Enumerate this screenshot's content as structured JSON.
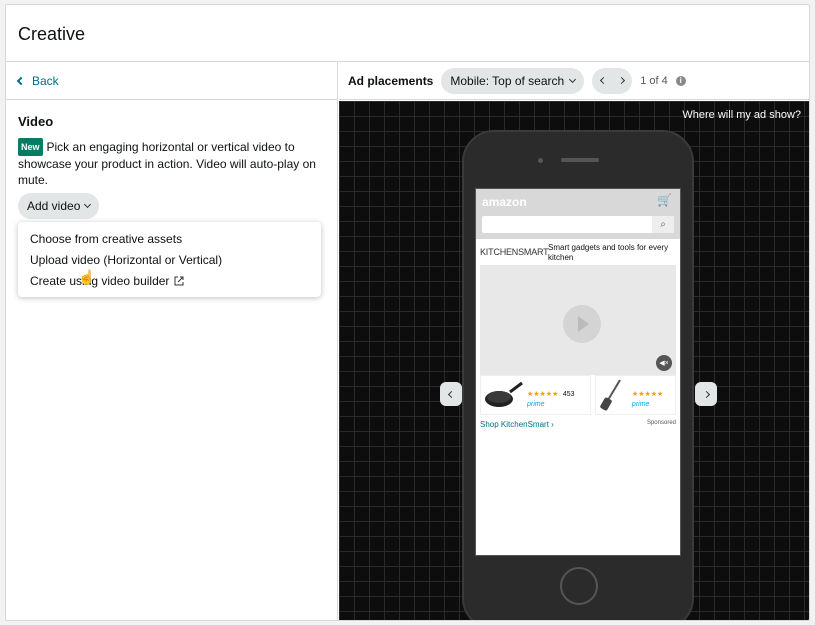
{
  "title": "Creative",
  "back": {
    "label": "Back"
  },
  "video": {
    "heading": "Video",
    "badge": "New",
    "description": "Pick an engaging horizontal or vertical video to showcase your product in action. Video will auto-play on mute.",
    "add_button": "Add video"
  },
  "dropdown": {
    "items": [
      {
        "label": "Choose from creative assets"
      },
      {
        "label": "Upload video (Horizontal or Vertical)"
      },
      {
        "label": "Create using video builder"
      }
    ]
  },
  "placements": {
    "label": "Ad placements",
    "selected": "Mobile: Top of search",
    "page": "1 of 4"
  },
  "preview": {
    "where_text": "Where will my ad show?",
    "amazon_logo": "amazon",
    "brand_logo": "KITCHENSMART",
    "tagline": "Smart gadgets and tools for every kitchen",
    "product1_count": "453",
    "prime": "prime",
    "shop_link": "Shop KitchenSmart ›",
    "sponsored": "Sponsored"
  },
  "colors": {
    "link": "#007185",
    "badge": "#067d62",
    "pill": "#e3e6e6"
  }
}
